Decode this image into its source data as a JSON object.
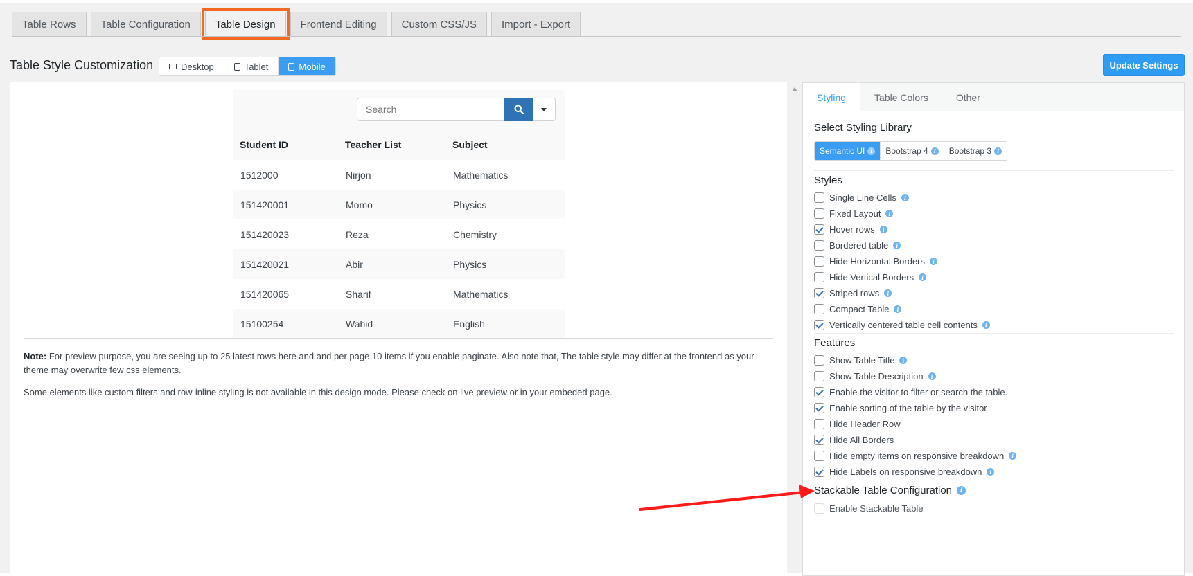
{
  "top_tabs": [
    "Table Rows",
    "Table Configuration",
    "Table Design",
    "Frontend Editing",
    "Custom CSS/JS",
    "Import - Export"
  ],
  "active_top_tab": "Table Design",
  "page_title": "Table Style Customization",
  "device_toggle": {
    "desktop": "Desktop",
    "tablet": "Tablet",
    "mobile": "Mobile",
    "active": "Mobile"
  },
  "update_button": "Update Settings",
  "preview": {
    "search_placeholder": "Search",
    "columns": [
      "Student ID",
      "Teacher List",
      "Subject"
    ],
    "rows": [
      [
        "1512000",
        "Nirjon",
        "Mathematics"
      ],
      [
        "151420001",
        "Momo",
        "Physics"
      ],
      [
        "151420023",
        "Reza",
        "Chemistry"
      ],
      [
        "151420021",
        "Abir",
        "Physics"
      ],
      [
        "151420065",
        "Sharif",
        "Mathematics"
      ],
      [
        "15100254",
        "Wahid",
        "English"
      ]
    ],
    "note_label": "Note:",
    "note_text": " For preview purpose, you are seeing up to 25 latest rows here and and per page 10 items if you enable paginate. Also note that, The table style may differ at the frontend as your theme may overwrite few css elements.",
    "note2": "Some elements like custom filters and row-inline styling is not available in this design mode. Please check on live preview or in your embeded page."
  },
  "settings": {
    "tabs": [
      "Styling",
      "Table Colors",
      "Other"
    ],
    "active_tab": "Styling",
    "library_title": "Select Styling Library",
    "libraries": [
      "Semantic UI",
      "Bootstrap 4",
      "Bootstrap 3"
    ],
    "active_library": "Semantic UI",
    "styles_title": "Styles",
    "styles": [
      {
        "label": "Single Line Cells",
        "checked": false,
        "info": true
      },
      {
        "label": "Fixed Layout",
        "checked": false,
        "info": true
      },
      {
        "label": "Hover rows",
        "checked": true,
        "info": true
      },
      {
        "label": "Bordered table",
        "checked": false,
        "info": true
      },
      {
        "label": "Hide Horizontal Borders",
        "checked": false,
        "info": true
      },
      {
        "label": "Hide Vertical Borders",
        "checked": false,
        "info": true
      },
      {
        "label": "Striped rows",
        "checked": true,
        "info": true
      },
      {
        "label": "Compact Table",
        "checked": false,
        "info": true
      },
      {
        "label": "Vertically centered table cell contents",
        "checked": true,
        "info": true
      }
    ],
    "features_title": "Features",
    "features": [
      {
        "label": "Show Table Title",
        "checked": false,
        "info": true
      },
      {
        "label": "Show Table Description",
        "checked": false,
        "info": true
      },
      {
        "label": "Enable the visitor to filter or search the table.",
        "checked": true,
        "info": false
      },
      {
        "label": "Enable sorting of the table by the visitor",
        "checked": true,
        "info": false
      },
      {
        "label": "Hide Header Row",
        "checked": false,
        "info": false
      },
      {
        "label": "Hide All Borders",
        "checked": true,
        "info": false
      },
      {
        "label": "Hide empty items on responsive breakdown",
        "checked": false,
        "info": true
      },
      {
        "label": "Hide Labels on responsive breakdown",
        "checked": true,
        "info": true
      }
    ],
    "stackable_title": "Stackable Table Configuration",
    "stackable_option": "Enable Stackable Table"
  },
  "colors": {
    "accent": "#2f9cf3",
    "highlight": "#f26a21",
    "annotation_arrow": "#ff1a1a"
  },
  "info_glyph": "i"
}
